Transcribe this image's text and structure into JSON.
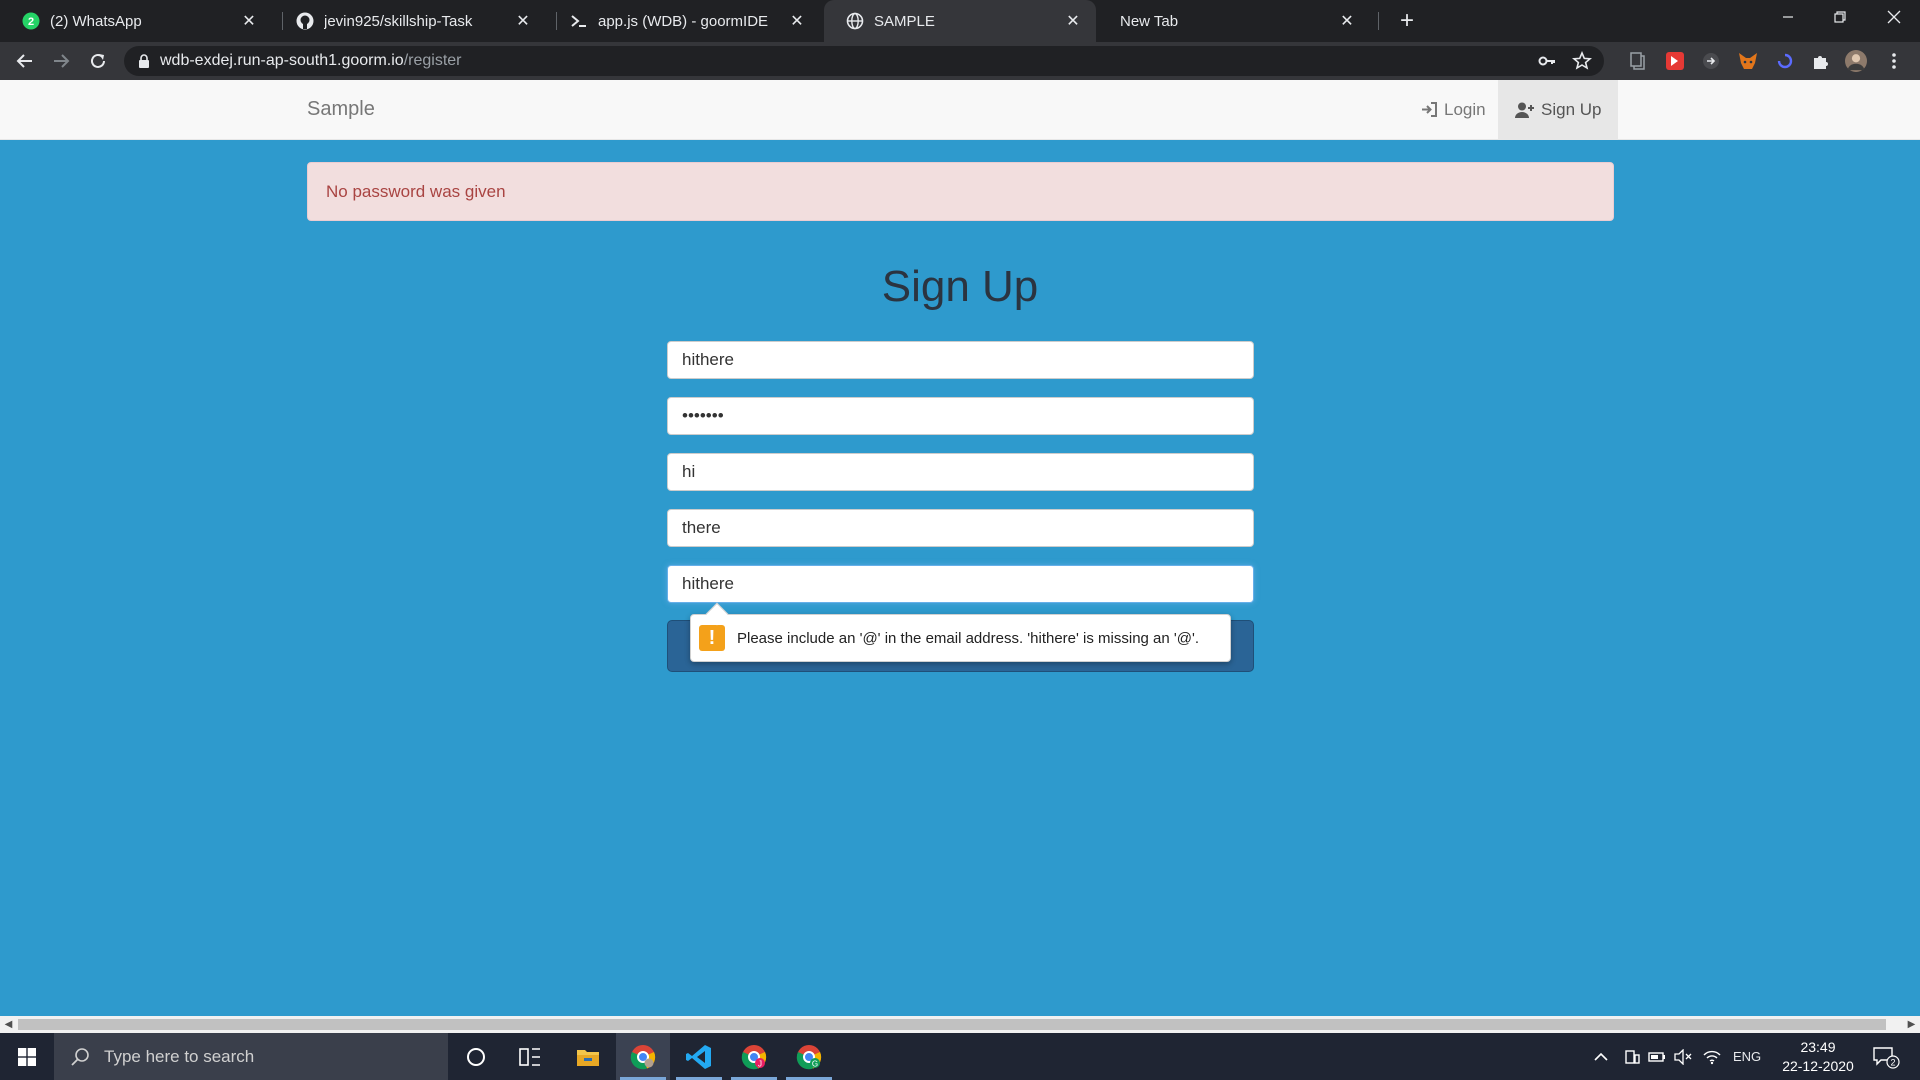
{
  "browser": {
    "tabs": [
      {
        "title": "(2) WhatsApp",
        "icon": "whatsapp-icon",
        "badge": "2"
      },
      {
        "title": "jevin925/skillship-Task",
        "icon": "github-icon"
      },
      {
        "title": "app.js (WDB) - goormIDE",
        "icon": "terminal-icon"
      },
      {
        "title": "SAMPLE",
        "icon": "globe-icon",
        "active": true
      },
      {
        "title": "New Tab",
        "icon": ""
      }
    ],
    "url_host": "wdb-exdej.run-ap-south1.goorm.io",
    "url_path": "/register"
  },
  "navbar": {
    "brand": "Sample",
    "login_label": "Login",
    "signup_label": "Sign Up"
  },
  "alert": {
    "message": "No password was given"
  },
  "form": {
    "heading": "Sign Up",
    "username": "hithere",
    "password": "•••••••",
    "first_name": "hi",
    "last_name": "there",
    "email": "hithere"
  },
  "validation": {
    "message": "Please include an '@' in the email address. 'hithere' is missing an '@'."
  },
  "taskbar": {
    "search_placeholder": "Type here to search",
    "language": "ENG",
    "time": "23:49",
    "date": "22-12-2020",
    "notification_count": "2"
  },
  "colors": {
    "page_bg": "#2e9acd",
    "alert_bg": "#f2dede",
    "alert_text": "#a94442",
    "button_bg": "#2a6496",
    "warning": "#f4a11a"
  }
}
